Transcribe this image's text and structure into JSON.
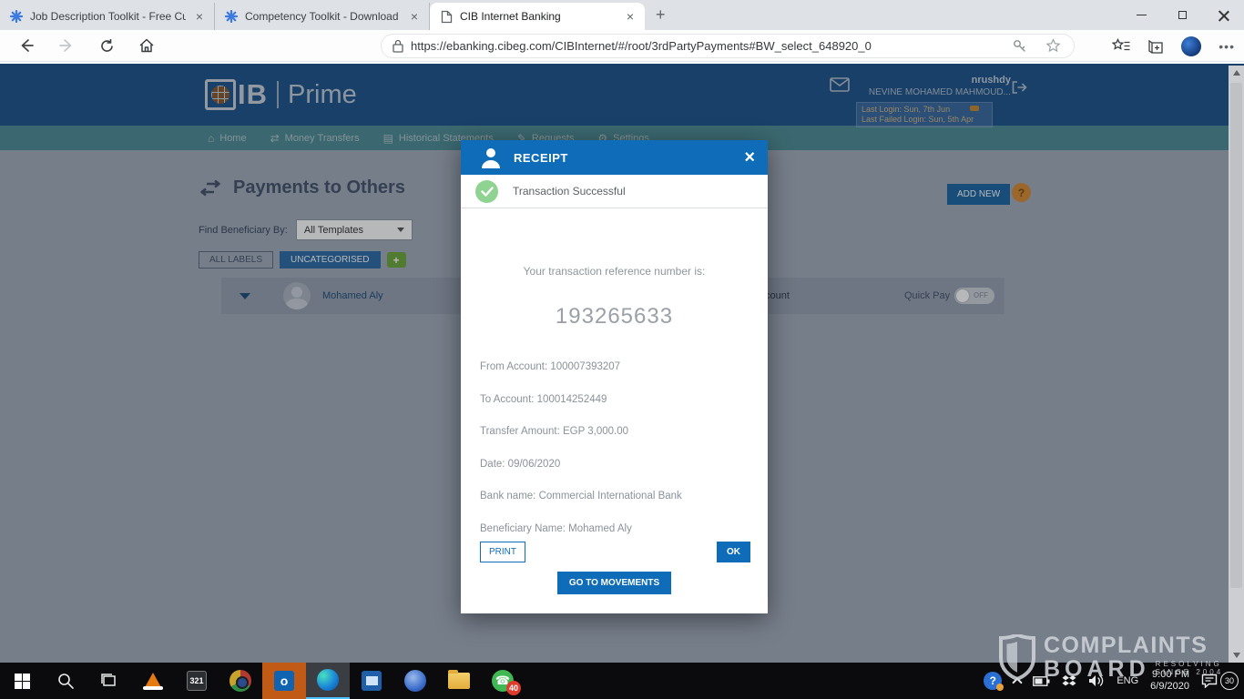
{
  "browser": {
    "tabs": [
      {
        "title": "Job Description Toolkit - Free Cu",
        "icon": "asterisk-favicon"
      },
      {
        "title": "Competency Toolkit - Download",
        "icon": "asterisk-favicon"
      },
      {
        "title": "CIB Internet Banking",
        "icon": "page-favicon"
      }
    ],
    "url": "https://ebanking.cibeg.com/CIBInternet/#/root/3rdPartyPayments#BW_select_648920_0"
  },
  "banner": {
    "logo_ib": "IB",
    "logo_prime": "Prime",
    "username": "nrushdy",
    "fullname": "NEVINE MOHAMED MAHMOUD...",
    "last_login": "Last Login: Sun, 7th Jun",
    "last_failed_login": "Last Failed Login: Sun, 5th Apr"
  },
  "nav": {
    "items": [
      "Home",
      "Money Transfers",
      "Historical Statements",
      "Requests",
      "Settings"
    ]
  },
  "page": {
    "title": "Payments to Others",
    "find_label": "Find Beneficiary By:",
    "dropdown_value": "All Templates",
    "all_labels_btn": "ALL LABELS",
    "uncategorised_btn": "UNCATEGORISED",
    "add_new_btn": "ADD NEW",
    "help_glyph": "?",
    "beneficiary": {
      "name": "Mohamed Aly",
      "partial_text": "count",
      "quick_pay_label": "Quick Pay",
      "quick_pay_state": "OFF"
    }
  },
  "modal": {
    "title": "RECEIPT",
    "status": "Transaction Successful",
    "ref_label": "Your transaction reference number is:",
    "ref_number": "193265633",
    "details": [
      "From Account: 100007393207",
      "To Account: 100014252449",
      "Transfer Amount: EGP 3,000.00",
      "Date: 09/06/2020",
      "Bank name: Commercial International Bank",
      "Beneficiary Name: Mohamed Aly"
    ],
    "print_btn": "PRINT",
    "ok_btn": "OK",
    "movements_btn": "GO TO MOVEMENTS"
  },
  "watermark": {
    "line1": "COMPLAINTS",
    "line2": "BOARD",
    "tag1": "RESOLVING",
    "tag2": "SINCE 2004"
  },
  "taskbar": {
    "mpc_label": "321",
    "outlook_glyph": "o",
    "whatsapp_glyph": "☎",
    "whatsapp_badge": "40",
    "lang": "ENG",
    "time": "9:00 PM",
    "date": "6/9/2020",
    "notif_count": "30"
  },
  "icons": {
    "plus": "+",
    "close": "×",
    "home": "⌂",
    "transfers": "⇄",
    "statements": "▤",
    "requests": "✎",
    "settings": "⚙"
  },
  "colors": {
    "modal_blue": "#0e6cb8",
    "banner_navy": "#1e538c",
    "nav_teal": "#4f8d96",
    "success_green": "#8fd393",
    "help_orange": "#d98c32",
    "uncategorised_blue": "#2d6ca5",
    "plus_green": "#6fa83c"
  }
}
